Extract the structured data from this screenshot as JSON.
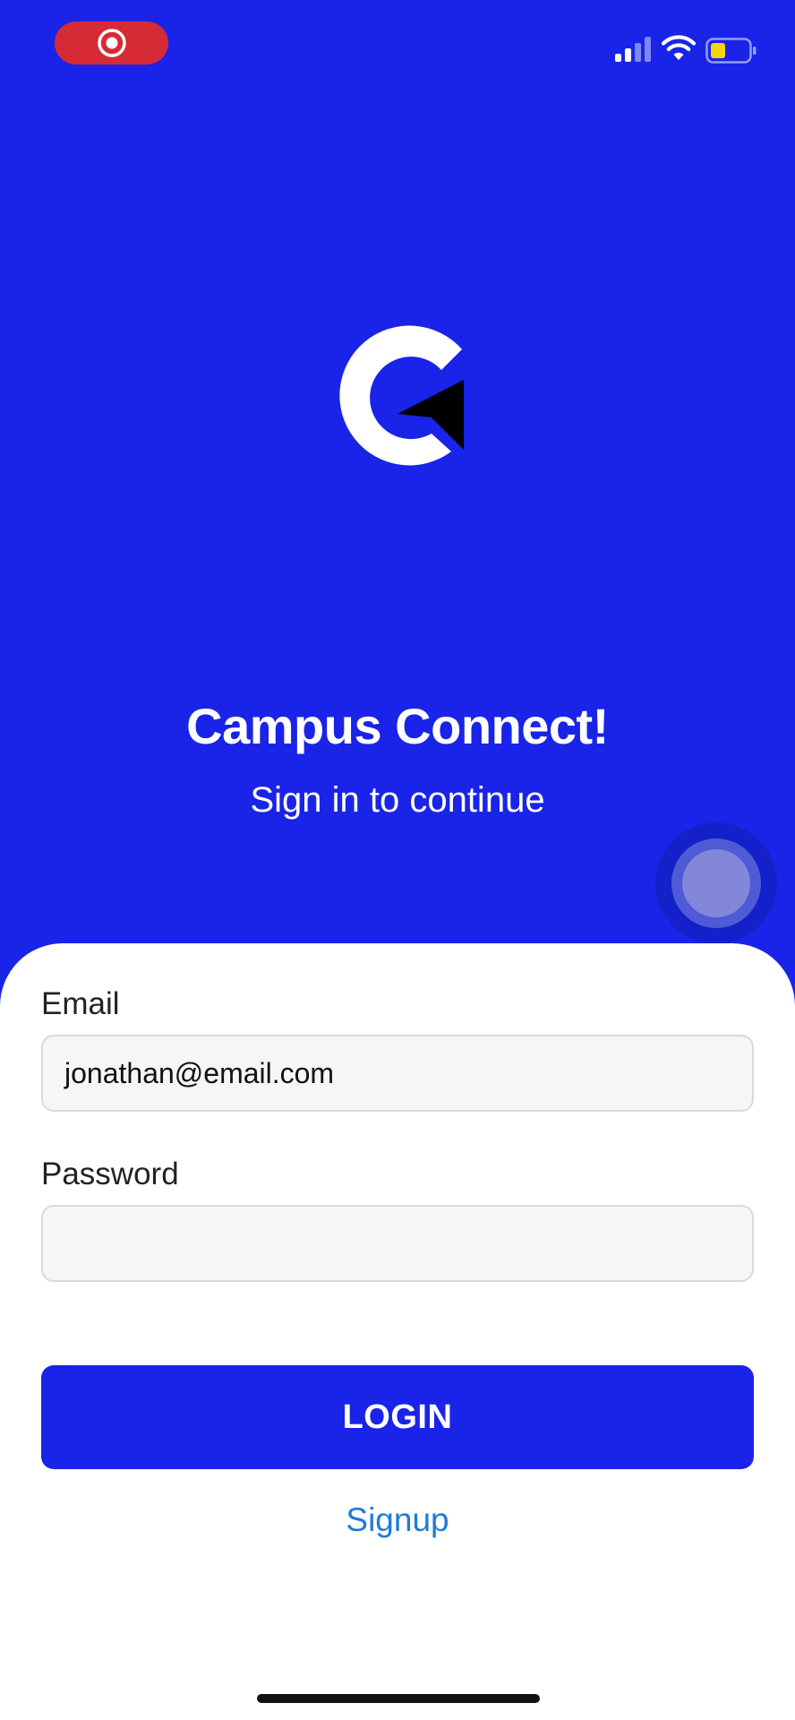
{
  "status_bar": {
    "recording_indicator": "screen-recording-pill",
    "signal_icon": "cellular-signal-icon",
    "wifi_icon": "wifi-icon",
    "battery_icon": "battery-low-icon"
  },
  "colors": {
    "brand_blue": "#1924E8",
    "link_blue": "#1E7BD9",
    "recording_red": "#D62B36"
  },
  "header": {
    "logo_icon": "campus-connect-logo",
    "title": "Campus Connect!",
    "subtitle": "Sign in to continue"
  },
  "form": {
    "email_label": "Email",
    "email_value": "jonathan@email.com",
    "password_label": "Password",
    "password_value": "",
    "login_label": "LOGIN",
    "signup_label": "Signup"
  }
}
